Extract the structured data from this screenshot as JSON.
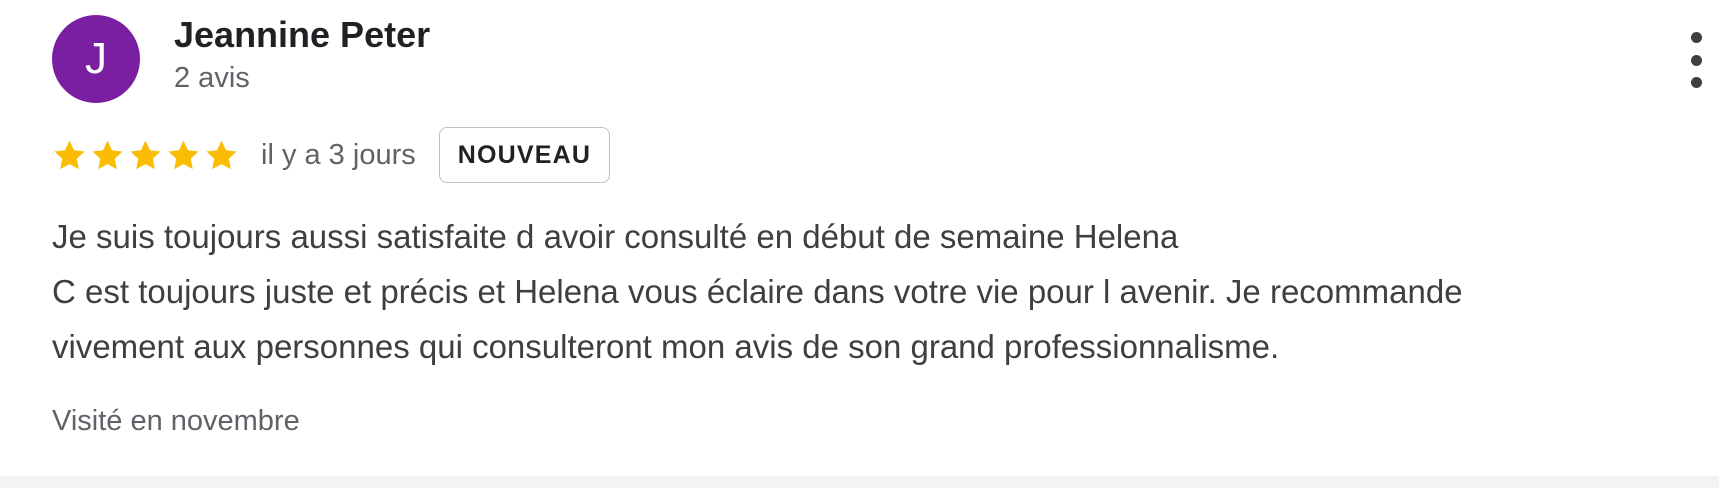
{
  "review": {
    "author": {
      "initial": "J",
      "name": "Jeannine Peter",
      "meta": "2 avis",
      "avatar_color": "#7b1fa2"
    },
    "menu_icon": "more-vert-icon",
    "rating": {
      "stars": 5,
      "max_stars": 5,
      "star_color": "#fbbc04",
      "date": "il y a 3 jours",
      "badge": "NOUVEAU"
    },
    "text_lines": [
      "Je suis toujours aussi satisfaite d avoir consulté en début de semaine Helena",
      "C est toujours juste et précis et Helena vous éclaire dans votre vie pour l avenir. Je recommande",
      "vivement aux personnes qui consulteront mon avis de son grand professionnalisme."
    ],
    "visited": "Visité en novembre"
  }
}
